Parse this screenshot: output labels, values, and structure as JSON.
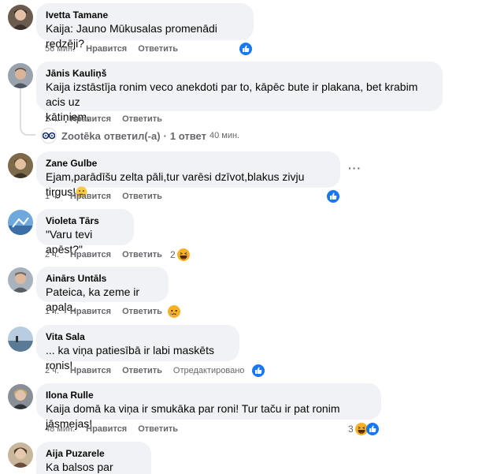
{
  "comments": [
    {
      "author": "Ivetta Tamane",
      "text": "Kaija: Jauno Mūkusalas promenādi redzēji?",
      "time": "56 мин.",
      "like": "Нравится",
      "reply": "Ответить"
    },
    {
      "author": "Jānis Kauliņš",
      "text1": "Kaija izstāstīja ronim veco anekdoti par to, kāpēc bute ir plakana, bet krabim acis uz",
      "text2": "kātiņiem.",
      "time": "2 ч.",
      "like": "Нравится",
      "reply": "Ответить"
    },
    {
      "author": "Zane Gulbe",
      "text": "Ejam,parādīšu zelta pāli,tur varēsi dzīvot,blakus zivju tirgus!",
      "time": "1 ч.",
      "like": "Нравится",
      "reply": "Ответить"
    },
    {
      "author": "Violeta Tārs",
      "text": "\"Varu tevi apēst?\"",
      "time": "2 ч.",
      "like": "Нравится",
      "reply": "Ответить",
      "react_count": "2"
    },
    {
      "author": "Ainārs Untāls",
      "text": "Pateica, ka zeme ir apaļa.",
      "time": "1 ч.",
      "like": "Нравится",
      "reply": "Ответить"
    },
    {
      "author": "Vita Sala",
      "text": "... ka viņa patiesībā ir labi maskēts ronis!",
      "time": "2 ч.",
      "like": "Нравится",
      "reply": "Ответить",
      "edited": "Отредактировано"
    },
    {
      "author": "Ilona Rulle",
      "text": "Kaija domā ka viņa ir smukāka par roni! Tur taču ir pat ronim jāsmejas!",
      "time": "48 мин.",
      "like": "Нравится",
      "reply": "Ответить",
      "react_count": "3"
    },
    {
      "author": "Aija Puzarele",
      "text": "Ka balsos par šleseru."
    }
  ],
  "reply_summary": {
    "page": "Zootēka",
    "action": "ответил(-а)",
    "sep": "·",
    "count": "1 ответ",
    "time": "40 мин."
  },
  "more_label": "···",
  "colors": {
    "bubble": "#f0f2f5",
    "meta": "#65676b",
    "like_blue": "#1877f2",
    "haha_yellow": "#f7b125"
  }
}
